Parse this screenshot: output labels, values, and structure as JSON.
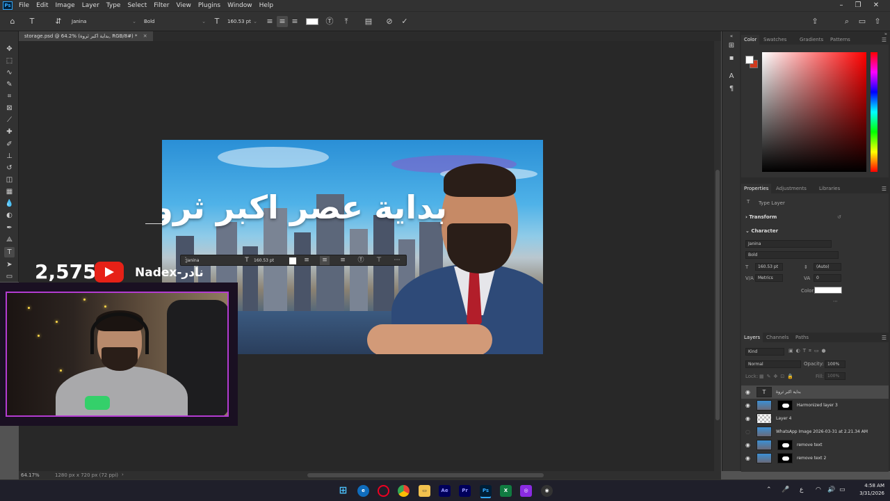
{
  "menubar": {
    "logo": "Ps",
    "items": [
      "File",
      "Edit",
      "Image",
      "Layer",
      "Type",
      "Select",
      "Filter",
      "View",
      "Plugins",
      "Window",
      "Help"
    ]
  },
  "options": {
    "font_family": "Janina",
    "font_style": "Bold",
    "font_size": "160.53 pt"
  },
  "document": {
    "tab_title": "storage.psd @ 64.2% (بداية اكبر ثروة, RGB/8#) *",
    "zoom": "64.17%",
    "dimensions": "1280 px x 720 px (72 ppi)"
  },
  "artwork": {
    "title_text": "بداية عصر اكبر ثروة"
  },
  "float_bar": {
    "font_family": "Janina",
    "font_size": "160.53 pt"
  },
  "stream": {
    "count": "2,575",
    "handle": "Nadex-نادر"
  },
  "panels": {
    "color_tabs": [
      "Color",
      "Swatches",
      "Gradients",
      "Patterns"
    ],
    "props_tabs": [
      "Properties",
      "Adjustments",
      "Libraries"
    ],
    "layer_type": "Type Layer",
    "transform": "Transform",
    "character": "Character",
    "char_font": "Janina",
    "char_style": "Bold",
    "char_size": "160.53 pt",
    "char_leading": "(Auto)",
    "char_kerning": "Metrics",
    "char_tracking": "0",
    "color_label": "Color",
    "layers_tabs": [
      "Layers",
      "Channels",
      "Paths"
    ],
    "blend_mode": "Normal",
    "opacity_label": "Opacity:",
    "opacity": "100%",
    "fill_label": "Fill:",
    "fill": "100%",
    "lock_label": "Lock:",
    "kind_label": "Kind",
    "layers": [
      {
        "name": "بداية اكبر ثروة",
        "type": "text"
      },
      {
        "name": "Harmonized layer 3",
        "type": "masked"
      },
      {
        "name": "Layer 4",
        "type": "plain"
      },
      {
        "name": "WhatsApp Image 2026-03-31 at 2.21.34 AM",
        "type": "photo"
      },
      {
        "name": "remove text",
        "type": "masked"
      },
      {
        "name": "remove text 2",
        "type": "masked"
      }
    ]
  },
  "taskbar": {
    "time": "4:58 AM",
    "date": "3/31/2026",
    "lang": "ع",
    "apps": [
      "Ae",
      "Pr",
      "Ps"
    ]
  },
  "colors": {
    "accent": "#31a8ff",
    "foreground": "#ffffff",
    "background": "#d03a1e",
    "youtube": "#e62117",
    "webcam_border": "#b43cd2"
  }
}
